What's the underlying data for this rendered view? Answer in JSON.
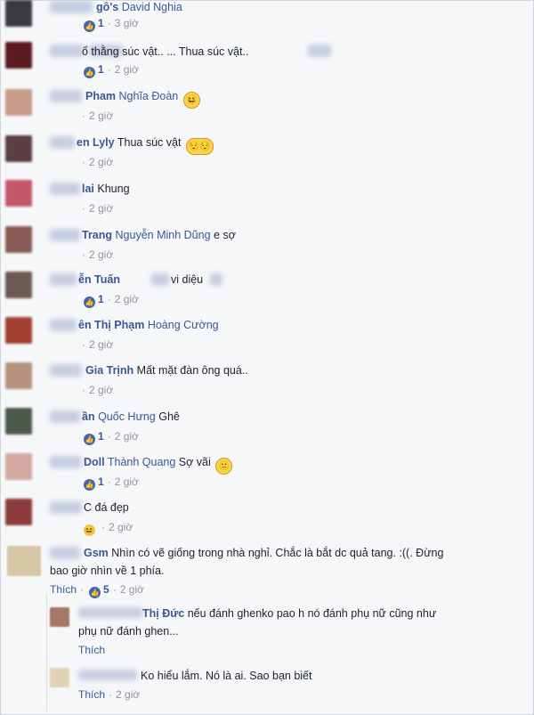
{
  "comments": [
    {
      "name": "gô's",
      "tag": "David Nghia",
      "text": "",
      "emoji": "",
      "likes": "1",
      "time": "3 giờ",
      "avatar_color": "#3a3b40"
    },
    {
      "name": "",
      "tag": "",
      "text": "ổ thằng súc vật.. ... Thua súc vật..",
      "emoji": "",
      "likes": "1",
      "time": "2 giờ",
      "avatar_color": "#5a1a1f"
    },
    {
      "name": "Pham",
      "tag": "Nghĩa Đoàn",
      "text": "",
      "emoji": "😆",
      "likes": "",
      "time": "2 giờ",
      "avatar_color": "#c79a8a"
    },
    {
      "name": "en Lyly",
      "tag": "",
      "text": "Thua súc vật",
      "emoji": "😌😌",
      "likes": "",
      "time": "2 giờ",
      "avatar_color": "#5b3f42"
    },
    {
      "name": "lai",
      "tag": "",
      "text": "Khung",
      "emoji": "",
      "likes": "",
      "time": "2 giờ",
      "avatar_color": "#c4586b"
    },
    {
      "name": "Trang",
      "tag": "Nguyễn Minh Dũng",
      "text": "e sợ",
      "emoji": "",
      "likes": "",
      "time": "2 giờ",
      "avatar_color": "#8a5a55"
    },
    {
      "name": "ễn Tuấn",
      "tag": "",
      "text": "vi diệu",
      "emoji": "",
      "likes": "1",
      "time": "2 giờ",
      "avatar_color": "#6d5a52"
    },
    {
      "name": "ên Thị Phạm",
      "tag": "Hoàng Cường",
      "text": "",
      "emoji": "",
      "likes": "",
      "time": "2 giờ",
      "avatar_color": "#a2412f"
    },
    {
      "name": "Gia Trịnh",
      "tag": "",
      "text": "Mất mặt đàn ông quá..",
      "emoji": "",
      "likes": "",
      "time": "2 giờ",
      "avatar_color": "#b7927e"
    },
    {
      "name": "ần",
      "tag": "Quốc Hưng",
      "text": "Ghê",
      "emoji": "",
      "likes": "1",
      "time": "2 giờ",
      "avatar_color": "#4c5a4a"
    },
    {
      "name": "Doll",
      "tag": "Thành Quang",
      "text": "Sợ vãi",
      "emoji": "🙁",
      "likes": "1",
      "time": "2 giờ",
      "avatar_color": "#d2a8a0"
    },
    {
      "name": "",
      "tag": "",
      "text": "C đá đẹp",
      "emoji": "",
      "likes": "",
      "time": "2 giờ",
      "avatar_color": "#8c3b3b"
    }
  ],
  "featured": {
    "name": "Gsm",
    "text_line1": "Nhìn có vẽ giống trong nhà nghỉ. Chắc là bắt dc quả tang. :((. Đừng",
    "text_line2": "bao giờ nhìn về 1 phía.",
    "like_label": "Thích",
    "likes": "5",
    "time": "2 giờ"
  },
  "replies": [
    {
      "name": "Thị Đức",
      "text_line1": "nếu đánh ghenko pao h nó đánh phụ nữ cũng như",
      "text_line2": "phụ nữ đánh ghen...",
      "like_label": "Thích"
    },
    {
      "name": "",
      "text_line1": "Ko hiểu lắm. Nó là ai. Sao bạn biết",
      "like_label": "Thích",
      "time": "2 giờ"
    }
  ]
}
